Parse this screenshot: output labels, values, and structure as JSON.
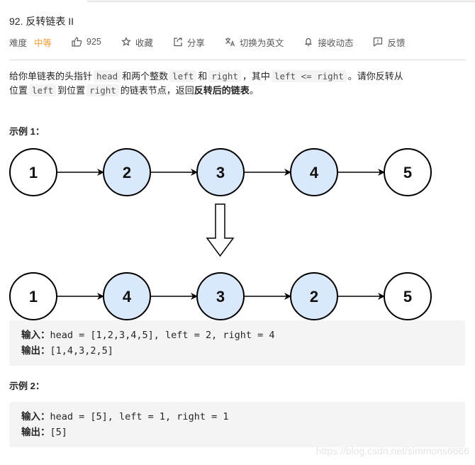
{
  "problem": {
    "title": "92. 反转链表 II"
  },
  "toolbar": {
    "difficulty_label": "难度",
    "difficulty_value": "中等",
    "difficulty_color": "#ef9b31",
    "likes": "925",
    "favorite_label": "收藏",
    "share_label": "分享",
    "switch_lang_label": "切换为英文",
    "subscribe_label": "接收动态",
    "feedback_label": "反馈"
  },
  "description": {
    "p1": "给你单链表的头指针",
    "c_head": "head",
    "p2": "和两个整数",
    "c_left": "left",
    "p3": "和",
    "c_right": "right",
    "p4": "，其中",
    "c_cond": "left <= right",
    "p5": "。请你反转从",
    "p6": "位置",
    "c_left2": "left",
    "p7": "到位置",
    "c_right2": "right",
    "p8": "的链表节点，返回",
    "bold": "反转后的链表",
    "p9": "。"
  },
  "examples": [
    {
      "title": "示例 1：",
      "input_label": "输入：",
      "input": "head = [1,2,3,4,5], left = 2, right = 4",
      "output_label": "输出：",
      "output": "[1,4,3,2,5]"
    },
    {
      "title": "示例 2：",
      "input_label": "输入：",
      "input": "head = [5], left = 1, right = 1",
      "output_label": "输出：",
      "output": "[5]"
    }
  ],
  "diagram": {
    "before": [
      {
        "label": "1",
        "highlight": false
      },
      {
        "label": "2",
        "highlight": true
      },
      {
        "label": "3",
        "highlight": true
      },
      {
        "label": "4",
        "highlight": true
      },
      {
        "label": "5",
        "highlight": false
      }
    ],
    "after": [
      {
        "label": "1",
        "highlight": false
      },
      {
        "label": "4",
        "highlight": true
      },
      {
        "label": "3",
        "highlight": true
      },
      {
        "label": "2",
        "highlight": true
      },
      {
        "label": "5",
        "highlight": false
      }
    ],
    "highlight_color": "#dae8fc"
  },
  "watermark": "https://blog.csdn.net/simmons6666"
}
